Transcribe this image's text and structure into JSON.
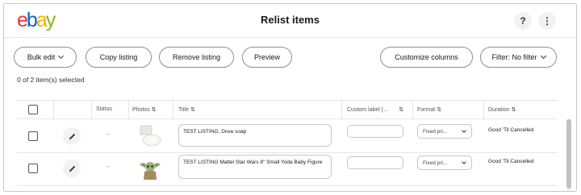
{
  "header": {
    "logo": {
      "letters": [
        "e",
        "b",
        "a",
        "y"
      ],
      "colors": [
        "#e53238",
        "#0064d2",
        "#f5af02",
        "#86b817"
      ]
    },
    "title": "Relist items",
    "help_icon": "?",
    "more_icon": "⋮"
  },
  "toolbar": {
    "bulk_edit": "Bulk edit",
    "copy_listing": "Copy listing",
    "remove_listing": "Remove listing",
    "preview": "Preview",
    "customize_columns": "Customize columns",
    "filter": "Filter: No filter"
  },
  "selection_status": "0 of 2 item(s) selected",
  "table": {
    "columns": {
      "status": "Status",
      "photos": "Photos",
      "title": "Title",
      "custom_label": "Custom label (…",
      "format": "Format",
      "duration": "Duration"
    },
    "sort_icon": "⇅",
    "rows": [
      {
        "status": "-",
        "title": "TEST LISTING, Dove soap",
        "format": "Fixed pri...",
        "duration": "Good 'Til Cancelled",
        "photo": "soap-photo"
      },
      {
        "status": "-",
        "title": "TEST LISTING Mattel Star Wars 8\" Small Yoda Baby Figure",
        "format": "Fixed pri...",
        "duration": "Good 'Til Cancelled",
        "photo": "yoda-figure-photo"
      }
    ]
  }
}
